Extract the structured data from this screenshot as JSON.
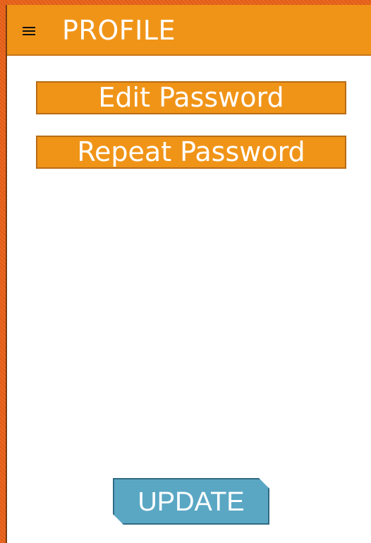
{
  "app_bar": {
    "menu_icon": "hamburger-menu-icon",
    "title": "PROFILE"
  },
  "fields": {
    "edit_password": "Edit Password",
    "repeat_password": "Repeat Password"
  },
  "actions": {
    "update_label": "UPDATE"
  },
  "colors": {
    "frame": "#e6621a",
    "header": "#f09418",
    "field_background": "#f09418",
    "update_button": "#5aa7c4",
    "text": "#ffffff"
  }
}
